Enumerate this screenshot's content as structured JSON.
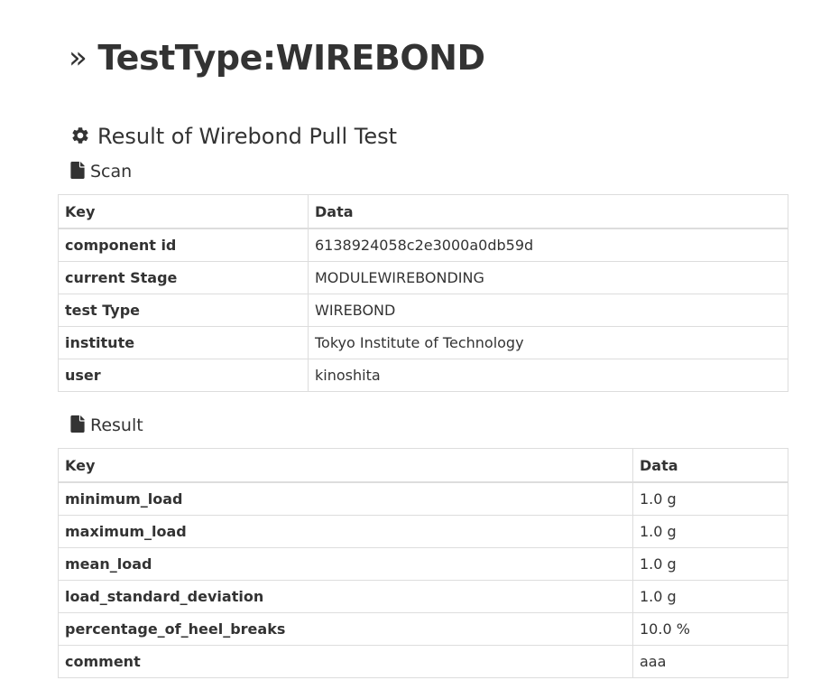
{
  "page": {
    "title": "TestType:WIREBOND",
    "title_icon": "double-chevron-right-icon"
  },
  "section": {
    "title": "Result of Wirebond Pull Test",
    "icon": "gear-icon"
  },
  "scan": {
    "heading": "Scan",
    "icon": "file-icon",
    "columns": [
      "Key",
      "Data"
    ],
    "rows": [
      {
        "key": "component id",
        "value": "6138924058c2e3000a0db59d"
      },
      {
        "key": "current Stage",
        "value": "MODULEWIREBONDING"
      },
      {
        "key": "test Type",
        "value": "WIREBOND"
      },
      {
        "key": "institute",
        "value": "Tokyo Institute of Technology"
      },
      {
        "key": "user",
        "value": "kinoshita"
      }
    ]
  },
  "result": {
    "heading": "Result",
    "icon": "file-icon",
    "columns": [
      "Key",
      "Data"
    ],
    "rows": [
      {
        "key": "minimum_load",
        "value": "1.0 g"
      },
      {
        "key": "maximum_load",
        "value": "1.0 g"
      },
      {
        "key": "mean_load",
        "value": "1.0 g"
      },
      {
        "key": "load_standard_deviation",
        "value": "1.0 g"
      },
      {
        "key": "percentage_of_heel_breaks",
        "value": "10.0 %"
      },
      {
        "key": "comment",
        "value": "aaa"
      }
    ]
  },
  "colors": {
    "text": "#333333",
    "border": "#dddddd",
    "background": "#ffffff"
  }
}
